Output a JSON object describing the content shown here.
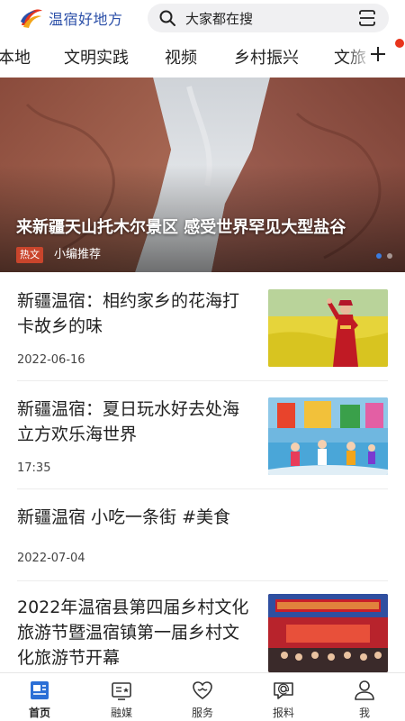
{
  "header": {
    "app_name": "温宿好地方",
    "search_placeholder": "大家都在搜"
  },
  "tabs": [
    "本地",
    "文明实践",
    "视频",
    "乡村振兴",
    "文旅"
  ],
  "banner": {
    "title": "来新疆天山托木尔景区  感受世界罕见大型盐谷",
    "tag": "热文",
    "subtitle": "小编推荐"
  },
  "news": [
    {
      "title": "新疆温宿：相约家乡的花海打卡故乡的味",
      "date": "2022-06-16"
    },
    {
      "title": "新疆温宿：夏日玩水好去处海立方欢乐海世界",
      "date": "17:35"
    },
    {
      "title": "新疆温宿 小吃一条街 #美食",
      "date": "2022-07-04"
    },
    {
      "title": "2022年温宿县第四届乡村文化旅游节暨温宿镇第一届乡村文化旅游节开幕",
      "date": ""
    }
  ],
  "bottom_nav": [
    {
      "label": "首页",
      "icon": "home-news-icon",
      "active": true
    },
    {
      "label": "融媒",
      "icon": "media-tv-icon",
      "active": false
    },
    {
      "label": "服务",
      "icon": "service-heart-icon",
      "active": false
    },
    {
      "label": "报料",
      "icon": "report-chat-icon",
      "active": false
    },
    {
      "label": "我",
      "icon": "profile-person-icon",
      "active": false
    }
  ],
  "colors": {
    "brand": "#2b4fa8",
    "accent": "#3a7ce0",
    "hot_tag": "#c9452c",
    "red_dot": "#e8341c"
  }
}
